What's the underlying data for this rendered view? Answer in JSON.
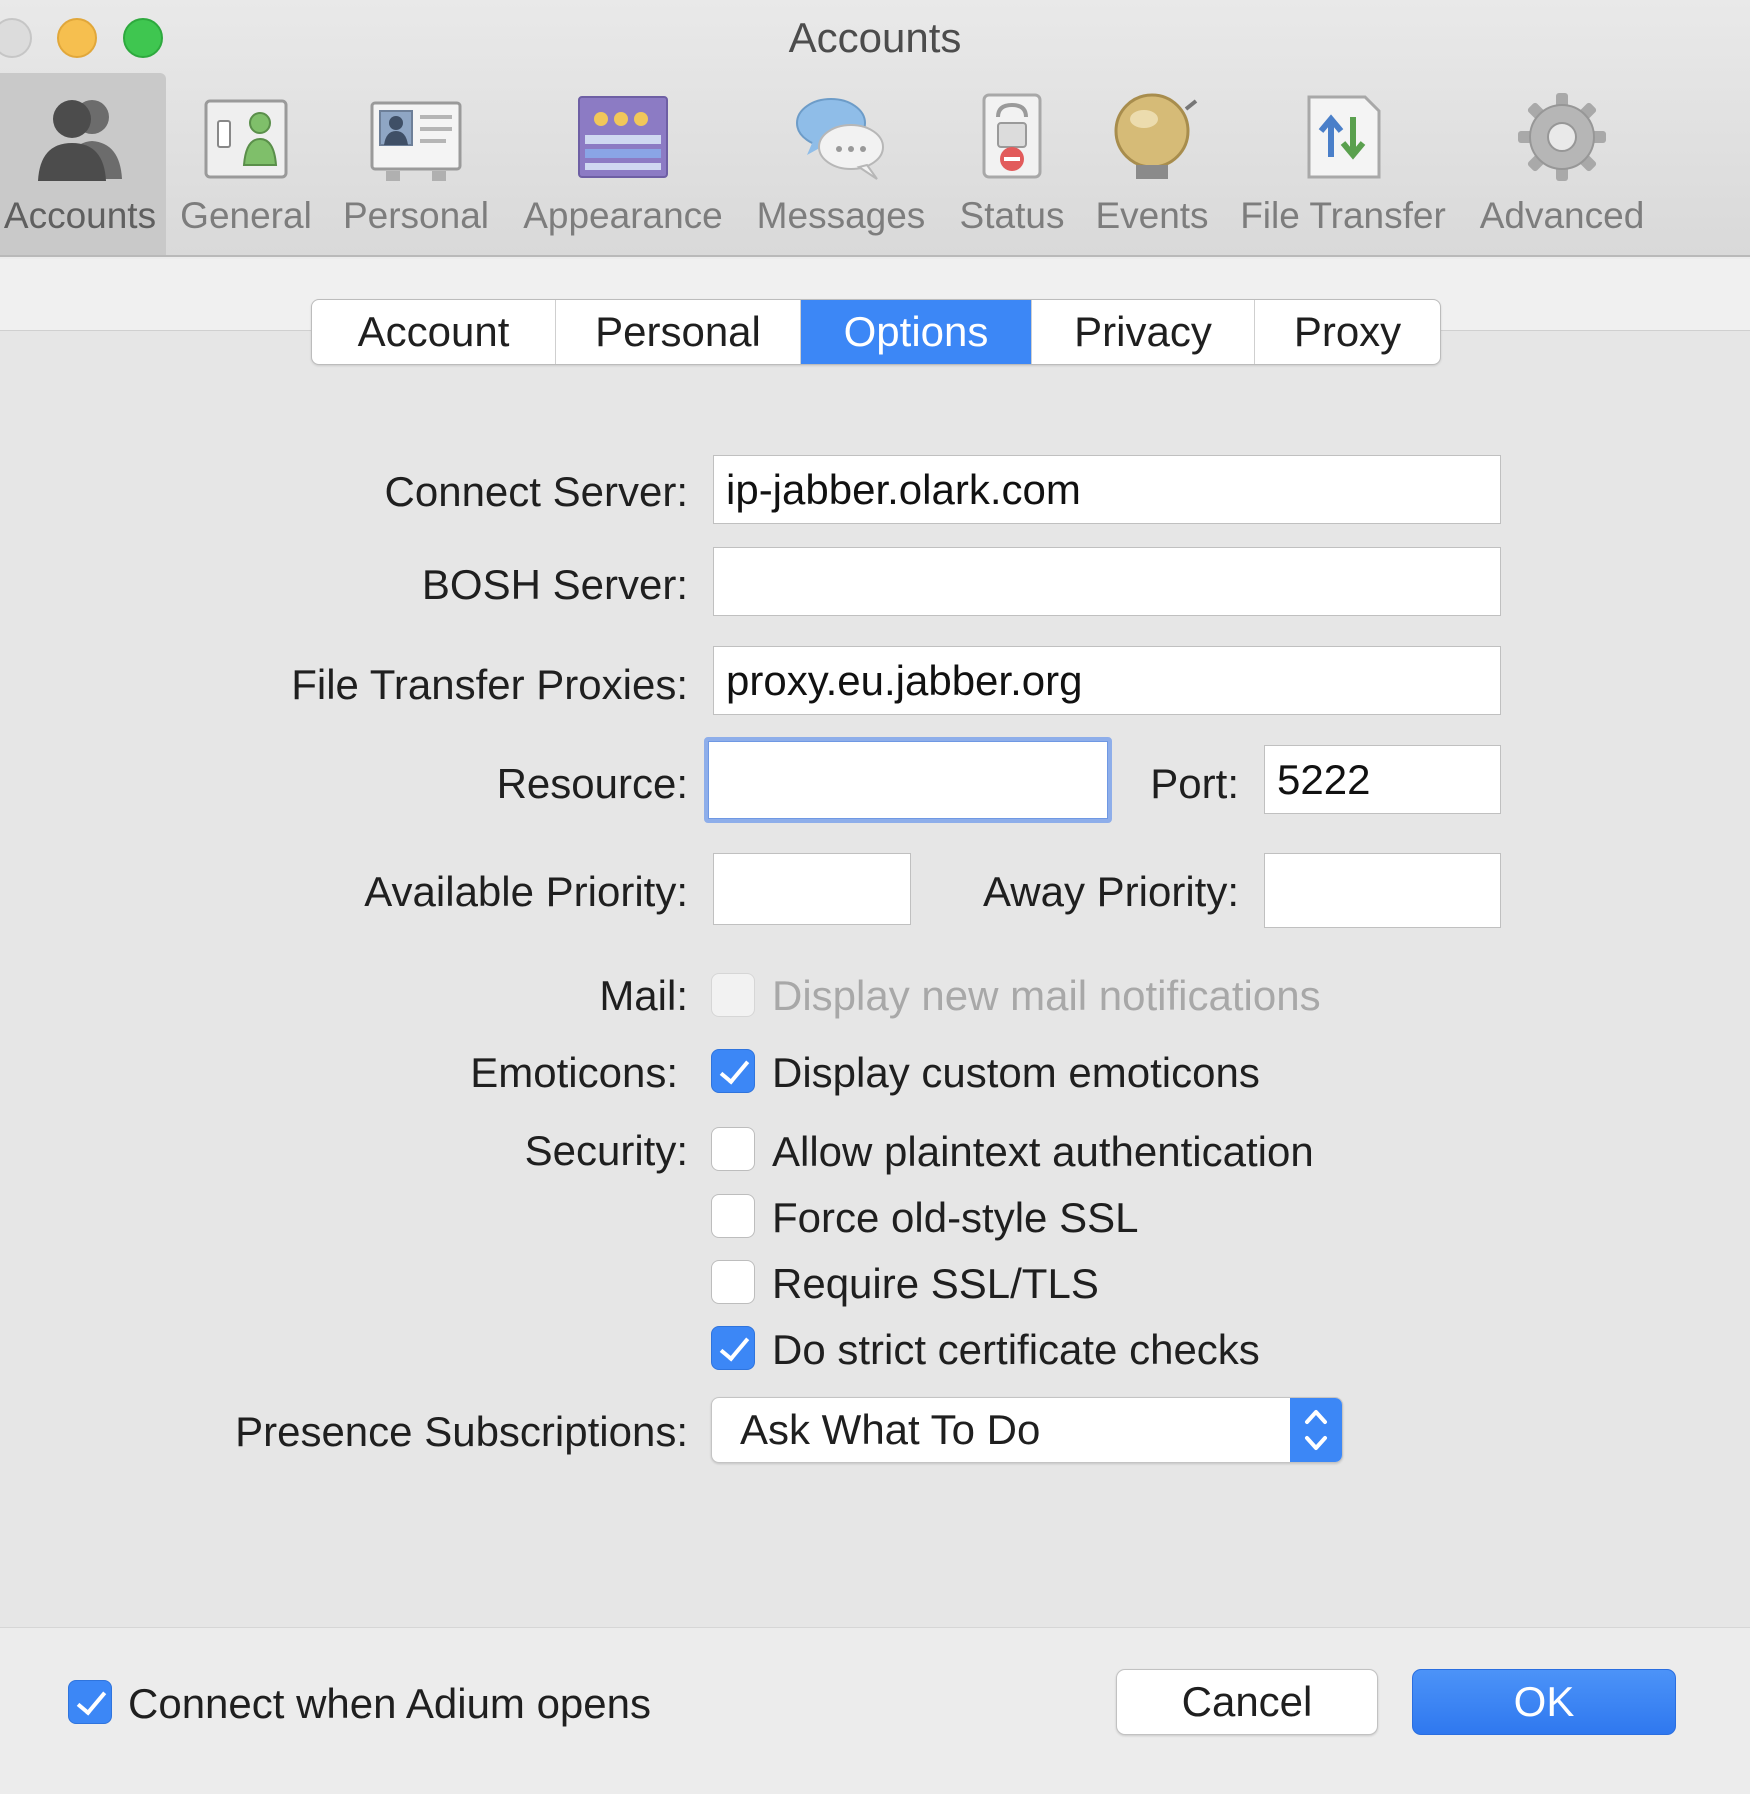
{
  "window": {
    "title": "Accounts"
  },
  "toolbar": {
    "items": [
      {
        "label": "Accounts",
        "icon": "accounts-icon",
        "selected": true
      },
      {
        "label": "General",
        "icon": "general-icon"
      },
      {
        "label": "Personal",
        "icon": "personal-icon"
      },
      {
        "label": "Appearance",
        "icon": "appearance-icon"
      },
      {
        "label": "Messages",
        "icon": "messages-icon"
      },
      {
        "label": "Status",
        "icon": "status-icon"
      },
      {
        "label": "Events",
        "icon": "events-icon"
      },
      {
        "label": "File Transfer",
        "icon": "file-transfer-icon"
      },
      {
        "label": "Advanced",
        "icon": "advanced-gear-icon"
      }
    ]
  },
  "tabs": {
    "items": [
      {
        "label": "Account"
      },
      {
        "label": "Personal"
      },
      {
        "label": "Options"
      },
      {
        "label": "Privacy"
      },
      {
        "label": "Proxy"
      }
    ],
    "active": "Options"
  },
  "form": {
    "connect_server": {
      "label": "Connect Server:",
      "value": "ip-jabber.olark.com"
    },
    "bosh_server": {
      "label": "BOSH Server:",
      "value": ""
    },
    "file_transfer_proxies": {
      "label": "File Transfer Proxies:",
      "value": "proxy.eu.jabber.org"
    },
    "resource": {
      "label": "Resource:",
      "value": ""
    },
    "port": {
      "label": "Port:",
      "value": "5222"
    },
    "available_priority": {
      "label": "Available Priority:",
      "value": ""
    },
    "away_priority": {
      "label": "Away Priority:",
      "value": ""
    },
    "mail": {
      "label": "Mail:",
      "option": "Display new mail notifications",
      "checked": false,
      "enabled": false
    },
    "emoticons": {
      "label": "Emoticons:",
      "option": "Display custom emoticons",
      "checked": true
    },
    "security": {
      "label": "Security:",
      "options": [
        {
          "text": "Allow plaintext authentication",
          "checked": false
        },
        {
          "text": "Force old-style SSL",
          "checked": false
        },
        {
          "text": "Require SSL/TLS",
          "checked": false
        },
        {
          "text": "Do strict certificate checks",
          "checked": true
        }
      ]
    },
    "presence_subscriptions": {
      "label": "Presence Subscriptions:",
      "value": "Ask What To Do"
    }
  },
  "footer": {
    "connect_on_open": {
      "text": "Connect when Adium opens",
      "checked": true
    },
    "cancel_label": "Cancel",
    "ok_label": "OK"
  },
  "colors": {
    "accent": "#3c87f6",
    "focus_ring": "#8eaeea"
  }
}
